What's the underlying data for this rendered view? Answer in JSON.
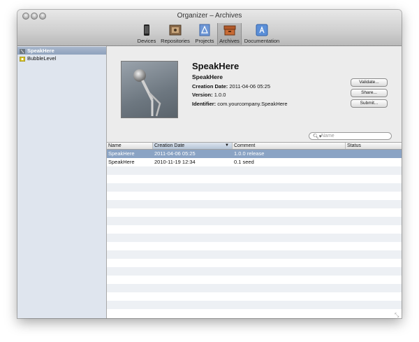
{
  "window": {
    "title": "Organizer – Archives"
  },
  "toolbar": {
    "items": [
      {
        "label": "Devices",
        "icon": "device-icon"
      },
      {
        "label": "Repositories",
        "icon": "repository-icon"
      },
      {
        "label": "Projects",
        "icon": "project-icon"
      },
      {
        "label": "Archives",
        "icon": "archive-icon"
      },
      {
        "label": "Documentation",
        "icon": "documentation-icon"
      }
    ],
    "selected": "Archives"
  },
  "sidebar": {
    "items": [
      {
        "label": "SpeakHere",
        "icon": "app-icon",
        "selected": true
      },
      {
        "label": "BubbleLevel",
        "icon": "app-icon",
        "selected": false
      }
    ]
  },
  "detail": {
    "app_name": "SpeakHere",
    "subtitle": "SpeakHere",
    "creation_label": "Creation Date:",
    "creation_value": "2011-04-06 05:25",
    "version_label": "Version:",
    "version_value": "1.0.0",
    "identifier_label": "Identifier:",
    "identifier_value": "com.yourcompany.SpeakHere",
    "icon": "microphone-icon",
    "buttons": {
      "validate": "Validate...",
      "share": "Share...",
      "submit": "Submit..."
    }
  },
  "search": {
    "placeholder": "Name",
    "icon": "search-icon"
  },
  "table": {
    "columns": [
      "Name",
      "Creation Date",
      "Comment",
      "Status"
    ],
    "sorted_column": "Creation Date",
    "rows": [
      {
        "name": "SpeakHere",
        "date": "2011-04-06 05:25",
        "comment": "1.0.0 release",
        "status": "",
        "selected": true
      },
      {
        "name": "SpeakHere",
        "date": "2010-11-19 12:34",
        "comment": "0.1 seed",
        "status": "",
        "selected": false
      }
    ]
  },
  "colors": {
    "selection": "#8aa3c4",
    "sidebar_bg": "#dfe5ee",
    "row_alt": "#edf0f4"
  }
}
